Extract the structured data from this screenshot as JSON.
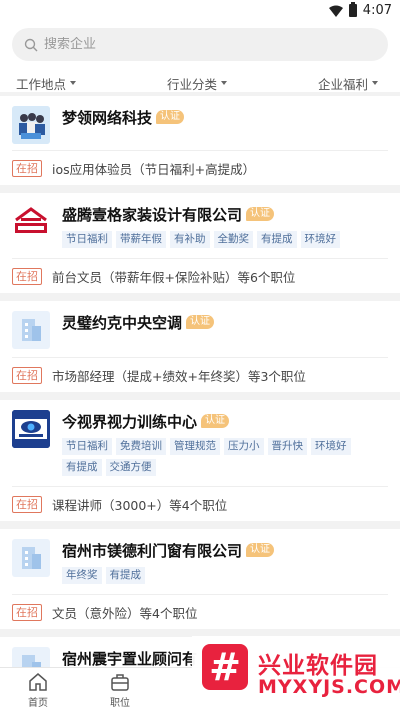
{
  "status_bar": {
    "time": "4:07"
  },
  "search": {
    "placeholder": "搜索企业"
  },
  "filters": [
    {
      "label": "工作地点"
    },
    {
      "label": "行业分类"
    },
    {
      "label": "企业福利"
    }
  ],
  "hiring_label": "在招",
  "certified_label": "认证",
  "companies": [
    {
      "name": "梦领网络科技",
      "logo_icon": "team-photo-logo",
      "tags": [],
      "jobs_text": "ios应用体验员（节日福利+高提成）"
    },
    {
      "name": "盛腾壹格家装设计有限公司",
      "logo_icon": "house-logo",
      "tags": [
        "节日福利",
        "带薪年假",
        "有补助",
        "全勤奖",
        "有提成",
        "环境好"
      ],
      "jobs_text": "前台文员（带薪年假+保险补贴）等6个职位"
    },
    {
      "name": "灵璧约克中央空调",
      "logo_icon": "building-placeholder-logo",
      "tags": [],
      "jobs_text": "市场部经理（提成+绩效+年终奖）等3个职位"
    },
    {
      "name": "今视界视力训练中心",
      "logo_icon": "eye-logo",
      "tags": [
        "节日福利",
        "免费培训",
        "管理规范",
        "压力小",
        "晋升快",
        "环境好",
        "有提成",
        "交通方便"
      ],
      "jobs_text": "课程讲师（3000+）等4个职位"
    },
    {
      "name": "宿州市镁德利门窗有限公司",
      "logo_icon": "building-placeholder-logo",
      "tags": [
        "年终奖",
        "有提成"
      ],
      "jobs_text": "文员（意外险）等4个职位"
    },
    {
      "name": "宿州震宇置业顾问有",
      "logo_icon": "building-placeholder-logo",
      "tags": [],
      "jobs_text": ""
    }
  ],
  "bottom_nav": [
    {
      "label": "首页",
      "icon": "home-icon"
    },
    {
      "label": "职位",
      "icon": "briefcase-icon"
    }
  ],
  "watermark": {
    "symbol": "#",
    "title": "兴业软件园",
    "url": "MYXYJS.COM"
  },
  "colors": {
    "accent_red": "#e0775d",
    "cert_gold": "#f5c37a",
    "tag_blue": "#4f6f9a",
    "watermark_red": "#e8223e"
  }
}
